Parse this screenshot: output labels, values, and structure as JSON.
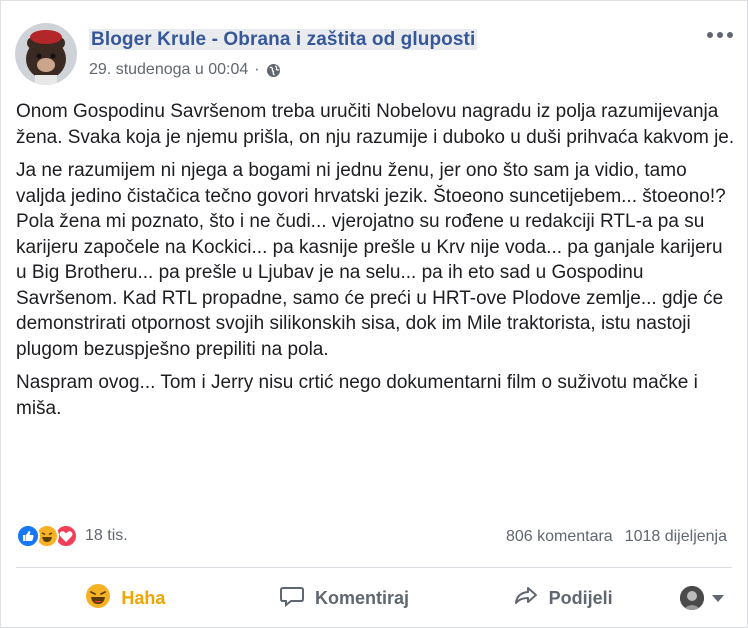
{
  "post": {
    "author": "Bloger Krule - Obrana i zaštita od gluposti",
    "timestamp": "29. studenoga u 00:04",
    "separator": "·",
    "paragraphs": [
      "Onom Gospodinu Savršenom treba uručiti Nobelovu nagradu iz polja razumijevanja žena. Svaka koja je njemu prišla, on nju razumije i duboko u duši prihvaća kakvom je.",
      "Ja ne razumijem ni njega a bogami ni jednu ženu, jer ono što sam ja vidio, tamo valjda jedino čistačica tečno govori hrvatski jezik. Štoeono suncetijebem... štoeono!? Pola žena mi poznato, što i ne čudi... vjerojatno su rođene u redakciji RTL-a pa su karijeru započele na Kockici... pa kasnije prešle u Krv nije voda... pa ganjale karijeru u Big Brotheru... pa prešle u Ljubav je na selu... pa ih eto sad u Gospodinu Savršenom. Kad RTL propadne, samo će preći u HRT-ove Plodove zemlje... gdje će demonstrirati otpornost svojih silikonskih sisa, dok im Mile traktorista, istu nastoji plugom bezuspješno prepiliti na pola.",
      "Naspram ovog... Tom i Jerry nisu crtić nego dokumentarni film o suživotu mačke i miša."
    ]
  },
  "reactions": {
    "count": "18 tis.",
    "icons": [
      "like-icon",
      "haha-icon",
      "love-icon"
    ]
  },
  "stats": {
    "comments": "806 komentara",
    "shares": "1018 dijeljenja"
  },
  "actions": {
    "haha": "Haha",
    "comment": "Komentiraj",
    "share": "Podijeli"
  },
  "colors": {
    "author_link": "#365899",
    "meta_text": "#616770",
    "like_blue": "#1877f2",
    "haha_yellow": "#f7b125",
    "love_red": "#f33e58"
  }
}
